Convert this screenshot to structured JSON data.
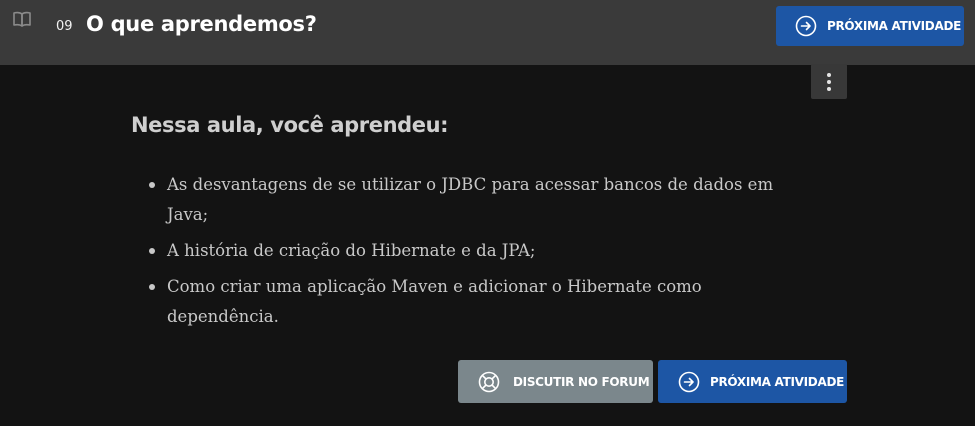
{
  "header": {
    "icon": "book-icon",
    "activity_number": "09",
    "activity_title": "O que aprendemos?",
    "next_button": {
      "label": "PRÓXIMA ATIVIDADE",
      "icon": "arrow-circle-right-icon"
    }
  },
  "menu": {
    "icon": "more-vertical-icon"
  },
  "content": {
    "heading": "Nessa aula, você aprendeu:",
    "items": [
      "As desvantagens de se utilizar o JDBC para acessar bancos de dados em Java;",
      "A história de criação do Hibernate e da JPA;",
      "Como criar uma aplicação Maven e adicionar o Hibernate como dependência."
    ]
  },
  "footer": {
    "forum_button": {
      "label": "DISCUTIR NO FORUM",
      "icon": "lifebuoy-icon"
    },
    "next_button": {
      "label": "PRÓXIMA ATIVIDADE",
      "icon": "arrow-circle-right-icon"
    }
  },
  "colors": {
    "header_bg": "#3a3a3a",
    "page_bg": "#131313",
    "primary_button": "#1d56a5",
    "secondary_button": "#7b878c"
  }
}
